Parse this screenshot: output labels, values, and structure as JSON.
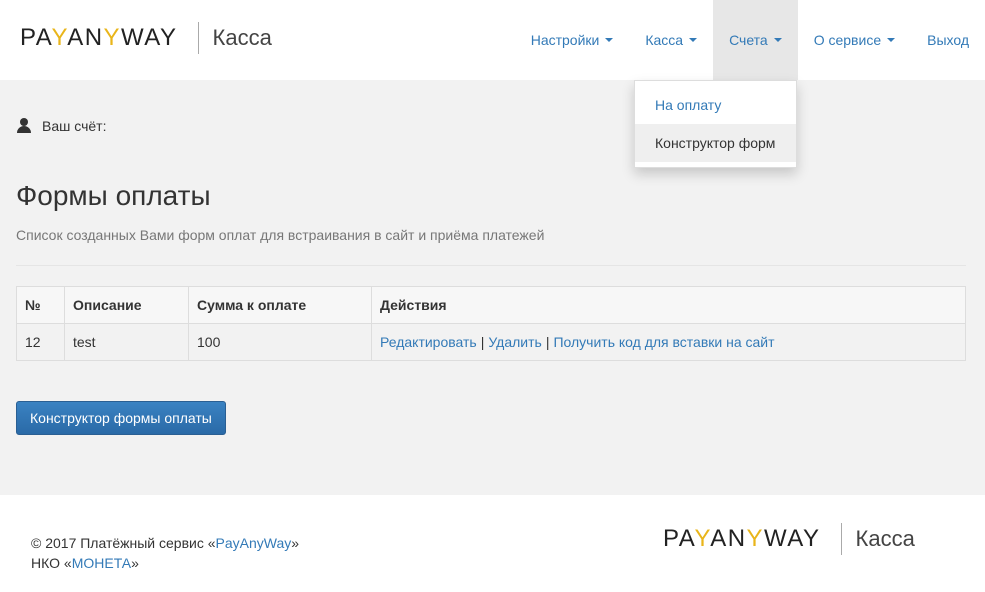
{
  "brand": {
    "word_part1": "PA",
    "word_y1": "Y",
    "word_part2": "AN",
    "word_y2": "Y",
    "word_part3": "WAY",
    "product": "Касса"
  },
  "nav": {
    "items": [
      {
        "label": "Настройки"
      },
      {
        "label": "Касса"
      },
      {
        "label": "Счета"
      },
      {
        "label": "О сервисе"
      },
      {
        "label": "Выход"
      }
    ],
    "dropdown": [
      {
        "label": "На оплату"
      },
      {
        "label": "Конструктор форм"
      }
    ]
  },
  "account": {
    "label": "Ваш счёт:"
  },
  "page": {
    "title": "Формы оплаты",
    "subtitle": "Список созданных Вами форм оплат для встраивания в сайт и приёма платежей"
  },
  "table": {
    "headers": [
      "№",
      "Описание",
      "Сумма к оплате",
      "Действия"
    ],
    "rows": [
      {
        "id": "12",
        "description": "test",
        "amount": "100",
        "actions": [
          "Редактировать",
          "Удалить",
          "Получить код для вставки на сайт"
        ],
        "separator": "|"
      }
    ]
  },
  "button": {
    "label": "Конструктор формы оплаты"
  },
  "footer": {
    "line1_prefix": "© 2017 Платёжный сервис «",
    "line1_link": "PayAnyWay",
    "line1_suffix": "»",
    "line2_prefix": "НКО «",
    "line2_link": "МОНЕТА",
    "line2_suffix": "»"
  },
  "colors": {
    "link": "#337ab7",
    "logo_accent": "#e9b51a",
    "primary_button": "#2e6fac",
    "page_background": "#f2f2f2"
  }
}
